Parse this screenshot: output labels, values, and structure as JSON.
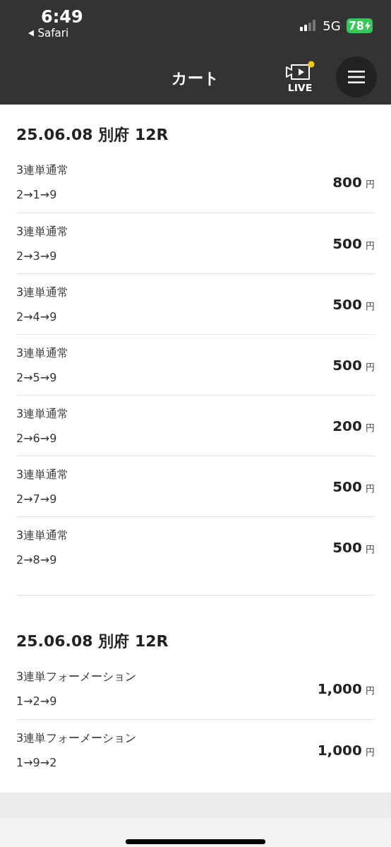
{
  "status_bar": {
    "time": "6:49",
    "back_label": "Safari",
    "network": "5G",
    "battery": "78"
  },
  "header": {
    "title": "カート",
    "live_label": "LIVE"
  },
  "sections": [
    {
      "title": "25.06.08 別府 12R",
      "bets": [
        {
          "type": "3連単通常",
          "combination": "2→1→9",
          "amount": "800",
          "unit": "円"
        },
        {
          "type": "3連単通常",
          "combination": "2→3→9",
          "amount": "500",
          "unit": "円"
        },
        {
          "type": "3連単通常",
          "combination": "2→4→9",
          "amount": "500",
          "unit": "円"
        },
        {
          "type": "3連単通常",
          "combination": "2→5→9",
          "amount": "500",
          "unit": "円"
        },
        {
          "type": "3連単通常",
          "combination": "2→6→9",
          "amount": "200",
          "unit": "円"
        },
        {
          "type": "3連単通常",
          "combination": "2→7→9",
          "amount": "500",
          "unit": "円"
        },
        {
          "type": "3連単通常",
          "combination": "2→8→9",
          "amount": "500",
          "unit": "円"
        }
      ]
    },
    {
      "title": "25.06.08 別府 12R",
      "bets": [
        {
          "type": "3連単フォーメーション",
          "combination": "1→2→9",
          "amount": "1,000",
          "unit": "円"
        },
        {
          "type": "3連単フォーメーション",
          "combination": "1→9→2",
          "amount": "1,000",
          "unit": "円"
        }
      ]
    }
  ]
}
